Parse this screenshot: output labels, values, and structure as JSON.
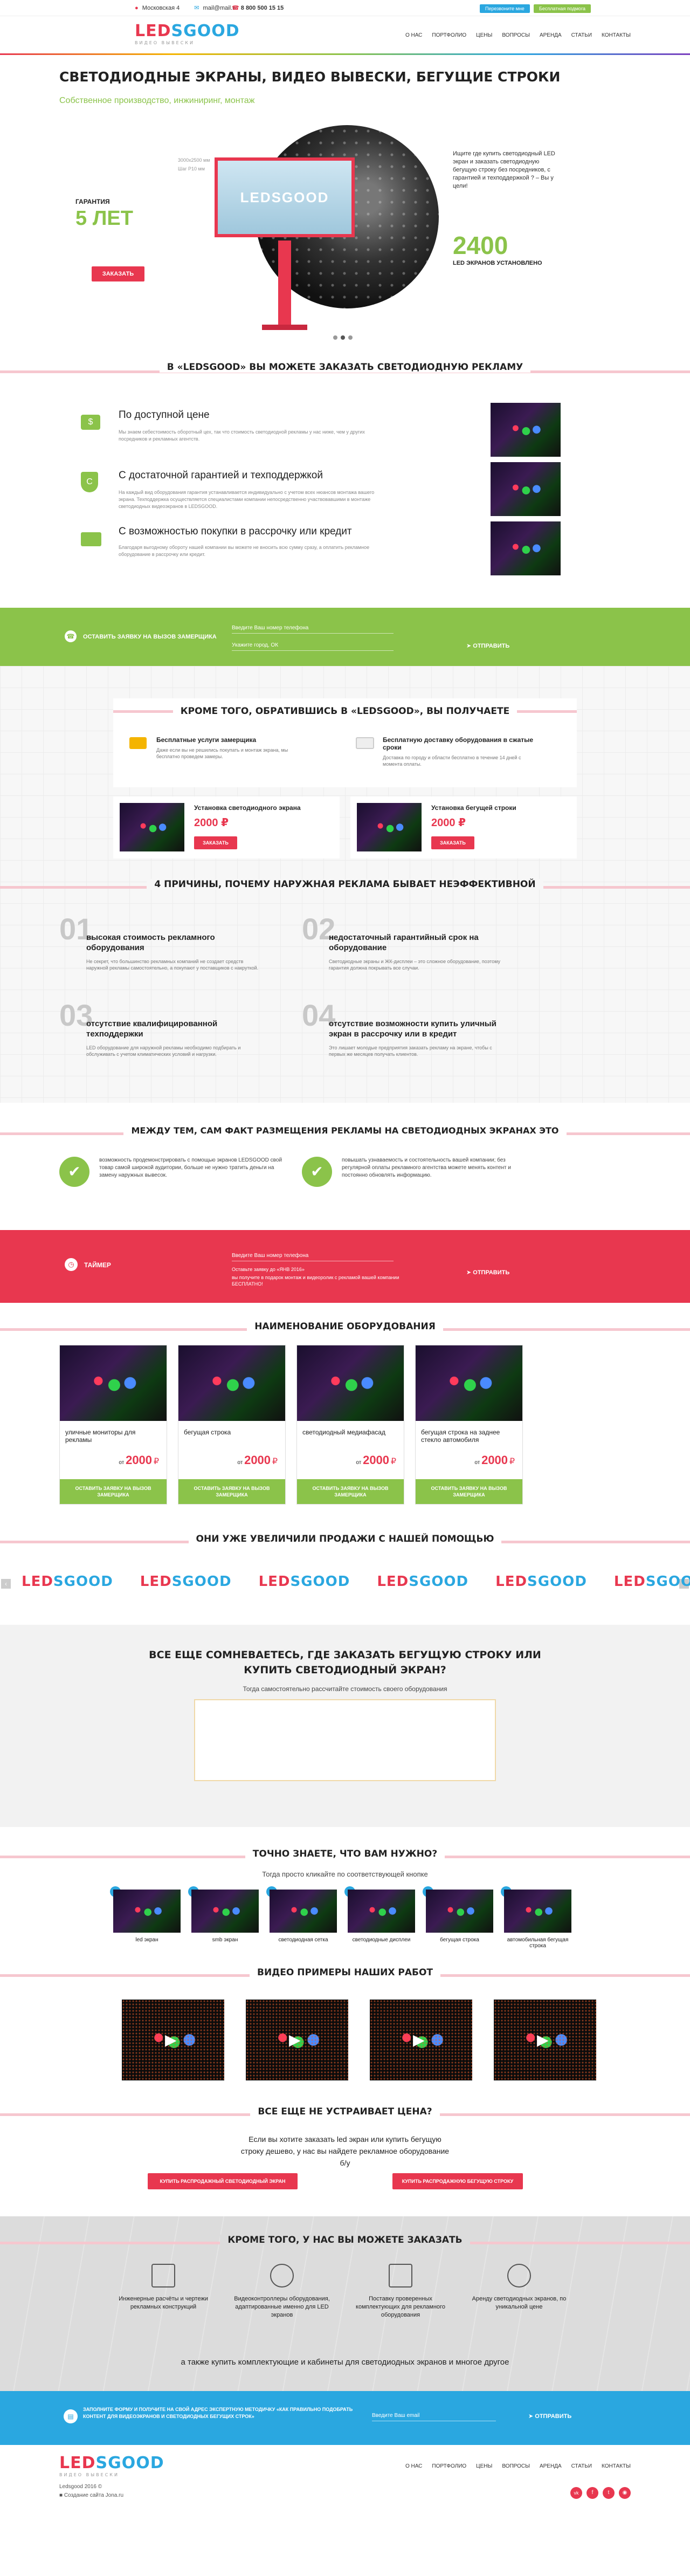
{
  "colors": {
    "accent": "#e8374f",
    "green": "#8bc34a",
    "blue": "#2aa7e0",
    "pink": "#f6c7cf"
  },
  "topbar": {
    "address": "Московская 4",
    "email": "mail@mail.ru",
    "phone": "8 800 500 15 15",
    "btn_call": "Перезвоните мне",
    "btn_consult": "Бесплатная подмога"
  },
  "logo": {
    "part1": "LED",
    "part2": "SGOOD",
    "tagline": "ВИДЕО ВЫВЕСКИ"
  },
  "nav": [
    "О НАС",
    "ПОРТФОЛИО",
    "ЦЕНЫ",
    "ВОПРОСЫ",
    "АРЕНДА",
    "СТАТЬИ",
    "КОНТАКТЫ"
  ],
  "hero": {
    "title": "СВЕТОДИОДНЫЕ ЭКРАНЫ, ВИДЕО ВЫВЕСКИ, БЕГУЩИЕ СТРОКИ",
    "subtitle": "Собственное производство, инжиниринг, монтаж",
    "guarantee_label": "ГАРАНТИЯ",
    "guarantee_value": "5 ЛЕТ",
    "order_btn": "ЗАКАЗАТЬ",
    "spec1": "3000х2500 мм",
    "spec2": "Шаг P10 мм",
    "screen_logo": "LEDSGOOD",
    "right_text": "Ищите где купить светодиодный LED экран и заказать светодиодную бегущую строку без посредников, с гарантией и техподдержкой ? – Вы у цели!",
    "count": "2400",
    "count_label": "LED ЭКРАНОВ УСТАНОВЛЕНО"
  },
  "order": {
    "title": "В «LEDSGOOD» ВЫ МОЖЕТЕ ЗАКАЗАТЬ СВЕТОДИОДНУЮ РЕКЛАМУ",
    "items": [
      {
        "title": "По доступной цене",
        "text": "Мы знаем себестоимость оборотный цех, так что стоимость светодиодной рекламы у нас ниже, чем у других посредников и рекламных агентств."
      },
      {
        "title": "С достаточной гарантией и техподдержкой",
        "text": "На каждый вид оборудования гарантия устанавливается индивидуально с учетом всех нюансов монтажа вашего экрана. Техподдержка осуществляется специалистами компании непосредственно участвовавшими в монтаже светодиодных видеоэкранов в LEDSGOOD."
      },
      {
        "title": "С возможностью покупки в рассрочку или кредит",
        "text": "Благодаря выгодному обороту нашей компании вы можете не вносить всю сумму сразу, а оплатить рекламное оборудование в рассрочку или кредит."
      }
    ]
  },
  "callback1": {
    "label": "ОСТАВИТЬ ЗАЯВКУ НА ВЫЗОВ ЗАМЕРЩИКА",
    "phone_placeholder": "Введите Ваш номер телефона",
    "city_placeholder": "Укажите город, ОК",
    "submit": "ОТПРАВИТЬ"
  },
  "bonus": {
    "title": "КРОМЕ ТОГО, ОБРАТИВШИСЬ В «LEDSGOOD», ВЫ ПОЛУЧАЕТЕ",
    "items": [
      {
        "title": "Бесплатные услуги замерщика",
        "text": "Даже если вы не решились покупать и монтаж экрана, мы бесплатно проведем замеры."
      },
      {
        "title": "Бесплатную доставку оборудования в сжатые сроки",
        "text": "Доставка по городу и области бесплатно в течение 14 дней с момента оплаты."
      }
    ],
    "products": [
      {
        "name": "Установка светодиодного экрана",
        "price": "2000",
        "currency": "₽",
        "btn": "ЗАКАЗАТЬ"
      },
      {
        "name": "Установка бегущей строки",
        "price": "2000",
        "currency": "₽",
        "btn": "ЗАКАЗАТЬ"
      }
    ]
  },
  "reasons": {
    "title": "4 ПРИЧИНЫ, ПОЧЕМУ НАРУЖНАЯ РЕКЛАМА БЫВАЕТ НЕЭФФЕКТИВНОЙ",
    "items": [
      {
        "num": "01",
        "title": "высокая стоимость рекламного оборудования",
        "text": "Не секрет, что большинство рекламных компаний не создает средств наружной рекламы самостоятельно, а покупают у поставщиков с накруткой."
      },
      {
        "num": "02",
        "title": "недостаточный гарантийный срок на оборудование",
        "text": "Светодиодные экраны и ЖК-дисплеи – это сложное оборудование, поэтому гарантия должна покрывать все случаи."
      },
      {
        "num": "03",
        "title": "отсутствие квалифицированной техподдержки",
        "text": "LED оборудование для наружной рекламы необходимо подбирать и обслуживать с учетом климатических условий и нагрузки."
      },
      {
        "num": "04",
        "title": "отсутствие возможности купить уличный экран в рассрочку или в кредит",
        "text": "Это лишает молодые предприятия заказать рекламу на экране, чтобы с первых же месяцев получать клиентов."
      }
    ]
  },
  "facts": {
    "title": "МЕЖДУ ТЕМ, САМ ФАКТ РАЗМЕЩЕНИЯ РЕКЛАМЫ НА СВЕТОДИОДНЫХ ЭКРАНАХ ЭТО",
    "items": [
      {
        "text": "возможность продемонстрировать с помощью экранов LEDSGOOD свой товар самой широкой аудитории, больше не нужно тратить деньги на замену наружных вывесок."
      },
      {
        "text": "повышать узнаваемость и состоятельность вашей компании; без регулярной оплаты рекламного агентства можете менять контент и постоянно обновлять информацию."
      }
    ]
  },
  "timer": {
    "label": "ТАЙМЕР",
    "phone_placeholder": "Введите Ваш номер телефона",
    "offer1": "Оставьте заявку до «ЯНВ 2016»",
    "offer2": "вы получите в подарок монтаж и видеоролик с рекламой вашей компании БЕСПЛАТНО!",
    "submit": "ОТПРАВИТЬ"
  },
  "equipment": {
    "title": "НАИМЕНОВАНИЕ ОБОРУДОВАНИЯ",
    "items": [
      {
        "name": "уличные мониторы для рекламы",
        "from": "от",
        "price": "2000",
        "currency": "₽",
        "btn": "ОСТАВИТЬ ЗАЯВКУ НА ВЫЗОВ ЗАМЕРЩИКА"
      },
      {
        "name": "бегущая строка",
        "from": "от",
        "price": "2000",
        "currency": "₽",
        "btn": "ОСТАВИТЬ ЗАЯВКУ НА ВЫЗОВ ЗАМЕРЩИКА"
      },
      {
        "name": "светодиодный медиафасад",
        "from": "от",
        "price": "2000",
        "currency": "₽",
        "btn": "ОСТАВИТЬ ЗАЯВКУ НА ВЫЗОВ ЗАМЕРЩИКА"
      },
      {
        "name": "бегущая строка на заднее стекло автомобиля",
        "from": "от",
        "price": "2000",
        "currency": "₽",
        "btn": "ОСТАВИТЬ ЗАЯВКУ НА ВЫЗОВ ЗАМЕРЩИКА"
      }
    ]
  },
  "clients": {
    "title": "ОНИ УЖЕ УВЕЛИЧИЛИ ПРОДАЖИ С НАШЕЙ ПОМОЩЬЮ"
  },
  "calc": {
    "title": "ВСЕ ЕЩЕ СОМНЕВАЕТЕСЬ, ГДЕ ЗАКАЗАТЬ БЕГУЩУЮ СТРОКУ ИЛИ КУПИТЬ СВЕТОДИОДНЫЙ ЭКРАН?",
    "subtitle": "Тогда самостоятельно рассчитайте стоимость своего оборудования"
  },
  "know": {
    "title": "ТОЧНО ЗНАЕТЕ, ЧТО ВАМ НУЖНО?",
    "subtitle": "Тогда просто кликайте по соответствующей кнопке",
    "items": [
      "led экран",
      "smb экран",
      "светодиодная сетка",
      "светодиодные дисплеи",
      "бегущая строка",
      "автомобильная бегущая строка"
    ]
  },
  "video": {
    "title": "ВИДЕО ПРИМЕРЫ НАШИХ РАБОТ"
  },
  "price": {
    "title": "ВСЕ ЕЩЕ НЕ УСТРАИВАЕТ ЦЕНА?",
    "text": "Если вы хотите заказать led экран или купить бегущую строку дешево, у нас вы найдете рекламное оборудование б/у",
    "btn1": "КУПИТЬ РАСПРОДАЖНЫЙ СВЕТОДИОДНЫЙ ЭКРАН",
    "btn2": "КУПИТЬ РАСПРОДАЖНУЮ БЕГУЩУЮ СТРОКУ"
  },
  "extra": {
    "title": "КРОМЕ ТОГО, У НАС ВЫ МОЖЕТЕ ЗАКАЗАТЬ",
    "items": [
      "Инженерные расчёты и чертежи рекламных конструкций",
      "Видеоконтроллеры оборудования, адаптированные именно для LED экранов",
      "Поставку проверенных комплектующих для рекламного оборудования",
      "Аренду светодиодных экранов, по уникальной цене"
    ],
    "also": "а также купить комплектующие и кабинеты для светодиодных экранов и многое другое"
  },
  "bottomform": {
    "text": "ЗАПОЛНИТЕ ФОРМУ И ПОЛУЧИТЕ НА СВОЙ АДРЕС ЭКСПЕРТНУЮ МЕТОДИЧКУ «КАК ПРАВИЛЬНО ПОДОБРАТЬ КОНТЕНТ ДЛЯ ВИДЕОЭКРАНОВ И СВЕТОДИОДНЫХ БЕГУЩИХ СТРОК»",
    "placeholder": "Введите Ваш email",
    "submit": "ОТПРАВИТЬ"
  },
  "footer": {
    "copyright": "Ledsgood 2016 ©",
    "credit": "Создание сайта Jona.ru"
  }
}
